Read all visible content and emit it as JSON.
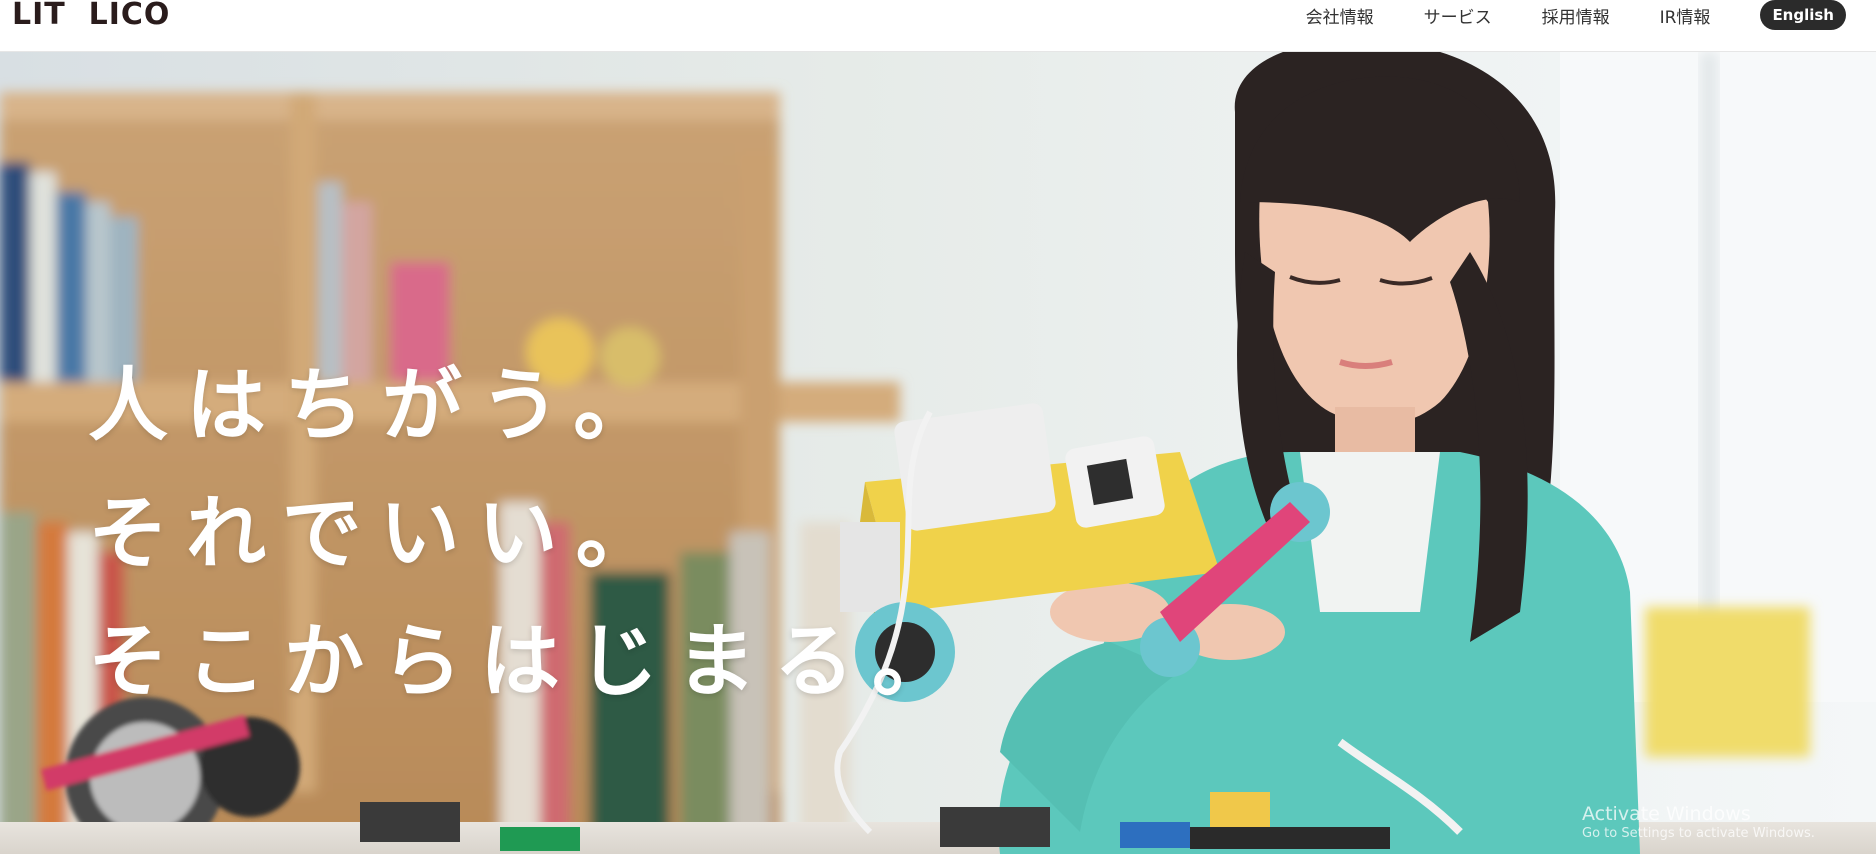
{
  "brand": {
    "logo_text": "LIT  LICO",
    "text_color": "#2a1c1c"
  },
  "nav": {
    "items": [
      {
        "label": "会社情報"
      },
      {
        "label": "サービス"
      },
      {
        "label": "採用情報"
      },
      {
        "label": "IR情報"
      }
    ],
    "english_label": "English",
    "english_bg": "#2b2b2b"
  },
  "hero": {
    "headline": [
      "人はちがう。",
      "それでいい。",
      "そこからはじまる。"
    ],
    "image_description_icon": "photo-girl-robot-icon",
    "colors": {
      "shelf": "#c49a6a",
      "cardigan": "#5cc8bc",
      "robot_yellow": "#f0d24a",
      "robot_pink": "#e0457a"
    }
  },
  "os_watermark": {
    "title": "Activate Windows",
    "subtitle": "Go to Settings to activate Windows."
  }
}
